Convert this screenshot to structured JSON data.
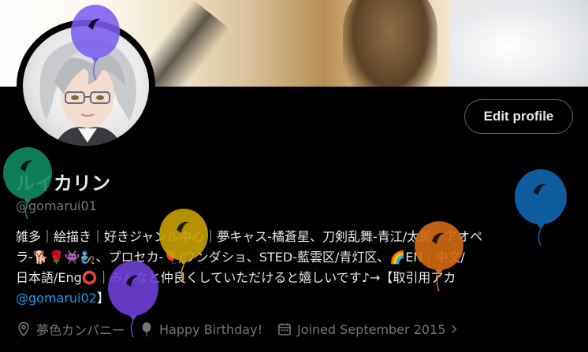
{
  "profile": {
    "display_name": "ルイカリン",
    "handle": "@gomarui01",
    "edit_button_label": "Edit profile",
    "bio_lines": [
      "雑多｜絵描き｜好きジャンル中心｜夢キャス-橘蒼星、刀剣乱舞-青江/太郎、アオペ",
      "ラ-🐕🌹👾🧞、プロセカ-🎈/ワンダショ、STED-藍雲区/青灯区、🌈EN｜中文/",
      "日本語/Eng⭕｜みんなと仲良くしていただけると嬉しいです♪→【取引用アカ"
    ],
    "bio_mention": "@gomarui02",
    "bio_tail": "】",
    "location": "夢色カンパニー",
    "birthday": "Happy Birthday!",
    "joined": "Joined September 2015"
  },
  "colors": {
    "background": "#000000",
    "text_primary": "#e7e9ea",
    "text_secondary": "#71767b",
    "link": "#1d9bf0",
    "button_border": "#536471"
  },
  "balloons": [
    {
      "name": "purple-balloon-top",
      "color": "#7b5cf0"
    },
    {
      "name": "green-balloon",
      "color": "#0f8a5f"
    },
    {
      "name": "yellow-balloon",
      "color": "#c9a000"
    },
    {
      "name": "orange-balloon",
      "color": "#d26a14"
    },
    {
      "name": "blue-balloon",
      "color": "#0f62a8"
    },
    {
      "name": "violet-balloon",
      "color": "#6d3fd6"
    }
  ],
  "icons": {
    "location": "location-pin-icon",
    "birthday": "balloon-icon",
    "joined": "calendar-icon"
  }
}
